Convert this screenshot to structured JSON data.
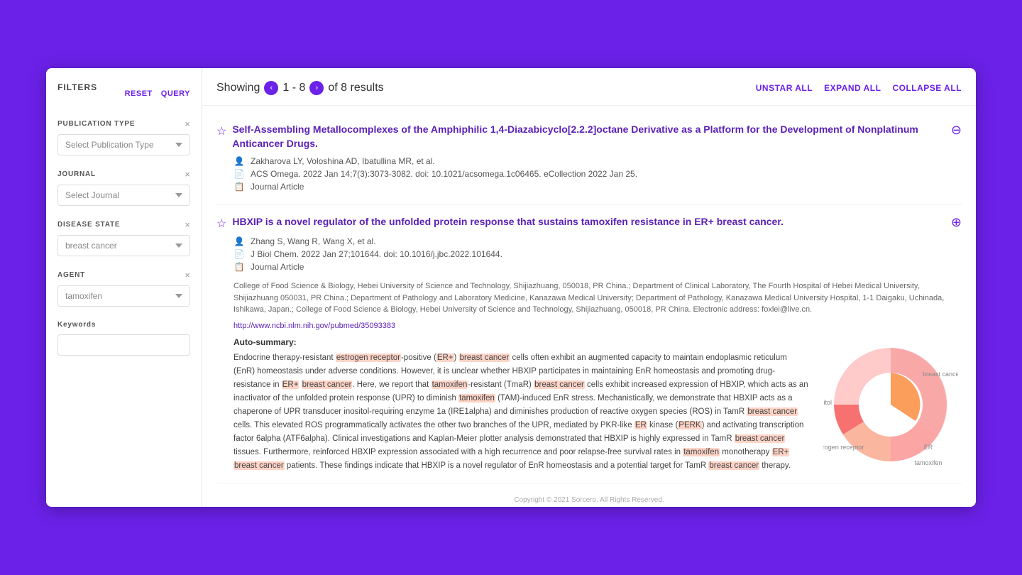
{
  "sidebar": {
    "title": "FILTERS",
    "reset_label": "RESET",
    "query_label": "QUERY",
    "publication_type": {
      "label": "PUBLICATION TYPE",
      "placeholder": "Select Publication Type",
      "value": ""
    },
    "journal": {
      "label": "JOURNAL",
      "placeholder": "Select Journal",
      "value": ""
    },
    "disease_state": {
      "label": "DISEASE STATE",
      "placeholder": "breast cancer",
      "value": "breast cancer"
    },
    "agent": {
      "label": "AGENT",
      "placeholder": "tamoxifen",
      "value": "tamoxifen"
    },
    "keywords": {
      "label": "Keywords",
      "placeholder": "",
      "value": ""
    }
  },
  "topbar": {
    "showing_label": "Showing",
    "range": "1 - 8",
    "total": "of 8 results",
    "unstar_all": "UNSTAR ALL",
    "expand_all": "EXPAND ALL",
    "collapse_all": "COLLAPSE ALL"
  },
  "results": [
    {
      "id": 1,
      "title": "Self-Assembling Metallocomplexes of the Amphiphilic 1,4-Diazabicyclo[2.2.2]octane Derivative as a Platform for the Development of Nonplatinum Anticancer Drugs.",
      "authors": "Zakharova LY, Voloshina AD, Ibatullina MR, et al.",
      "journal": "ACS Omega. 2022 Jan 14;7(3):3073-3082. doi: 10.1021/acsomega.1c06465. eCollection 2022 Jan 25.",
      "type": "Journal Article",
      "expanded": false
    },
    {
      "id": 2,
      "title": "HBXIP is a novel regulator of the unfolded protein response that sustains tamoxifen resistance in ER+ breast cancer.",
      "authors": "Zhang S, Wang R, Wang X, et al.",
      "journal": "J Biol Chem. 2022 Jan 27;101644. doi: 10.1016/j.jbc.2022.101644.",
      "type": "Journal Article",
      "expanded": true,
      "affiliation": "College of Food Science & Biology, Hebei University of Science and Technology, Shijiazhuang, 050018, PR China.; Department of Clinical Laboratory, The Fourth Hospital of Hebei Medical University, Shijiazhuang 050031, PR China.; Department of Pathology and Laboratory Medicine, Kanazawa Medical University; Department of Pathology, Kanazawa Medical University Hospital, 1-1 Daigaku, Uchinada, Ishikawa, Japan.; College of Food Science & Biology, Hebei University of Science and Technology, Shijiazhuang, 050018, PR China. Electronic address: foxlei@live.cn.",
      "link": "http://www.ncbi.nlm.nih.gov/pubmed/35093383",
      "auto_summary_title": "Auto-summary:",
      "auto_summary": "Endocrine therapy-resistant estrogen receptor-positive (ER+) breast cancer cells often exhibit an augmented capacity to maintain endoplasmic reticulum (EnR) homeostasis under adverse conditions. However, it is unclear whether HBXIP participates in maintaining EnR homeostasis and promoting drug-resistance in ER+ breast cancer. Here, we report that tamoxifen-resistant (TmaR) breast cancer cells exhibit increased expression of HBXIP, which acts as an inactivator of the unfolded protein response (UPR) to diminish tamoxifen (TAM)-induced EnR stress. Mechanistically, we demonstrate that HBXIP acts as a chaperone of UPR transducer inositol-requiring enzyme 1a (IRE1alpha) and diminishes production of reactive oxygen species (ROS) in TamR breast cancer cells. This elevated ROS programmatically activates the other two branches of the UPR, mediated by PKR-like ER kinase (PERK) and activating transcription factor 6alpha (ATF6alpha). Clinical investigations and Kaplan-Meier plotter analysis demonstrated that HBXIP is highly expressed in TamR breast cancer tissues. Furthermore, reinforced HBXIP expression associated with a high recurrence and poor relapse-free survival rates in tamoxifen monotherapy ER+ breast cancer patients. These findings indicate that HBXIP is a novel regulator of EnR homeostasis and a potential target for TamR breast cancer therapy."
    }
  ],
  "copyright": "Copyright © 2021 Sorcero. All Rights Reserved.",
  "chart": {
    "labels": [
      "ER",
      "breast cancer",
      "estrogen receptor",
      "inositol",
      "tamoxifen"
    ],
    "colors": [
      "#f9a8a8",
      "#f87171",
      "#fca5a5",
      "#fbb6a0",
      "#ef4444"
    ]
  }
}
